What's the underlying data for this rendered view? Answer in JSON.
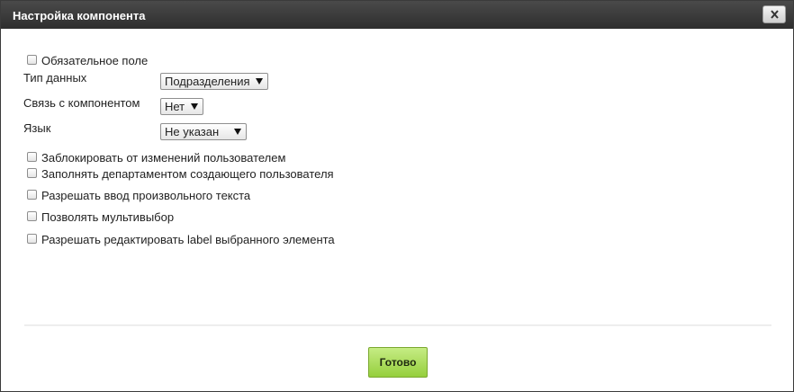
{
  "dialog": {
    "title": "Настройка компонента",
    "close_icon": "close-icon"
  },
  "form": {
    "required_label": "Обязательное поле",
    "data_type": {
      "label": "Тип данных",
      "value": "Подразделения"
    },
    "link": {
      "label": "Связь с компонентом",
      "value": "Нет"
    },
    "language": {
      "label": "Язык",
      "value": "Не указан"
    },
    "options": [
      "Заблокировать от изменений пользователем",
      "Заполнять департаментом создающего пользователя",
      "Разрешать ввод произвольного текста",
      "Позволять мультивыбор",
      "Разрешать редактировать label выбранного элемента"
    ]
  },
  "footer": {
    "done_label": "Готово"
  },
  "colors": {
    "titlebar": "#3a3a3a",
    "done_button": "#a8dc58"
  }
}
